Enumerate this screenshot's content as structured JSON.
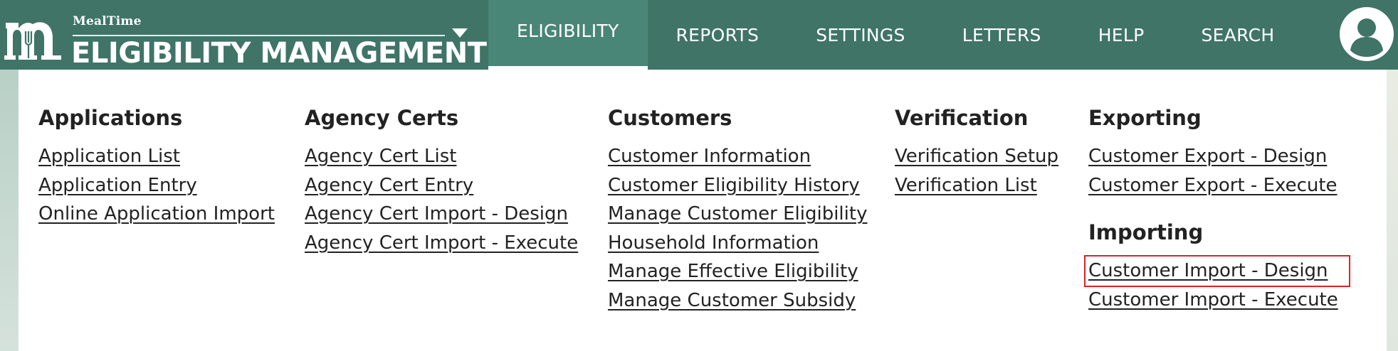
{
  "header": {
    "brand_small": "MealTime",
    "brand_title": "ELIGIBILITY MANAGEMENT",
    "logo_icon": "mealtime-m-fork-logo",
    "dropdown_icon": "caret-down-icon",
    "avatar_icon": "user-avatar-icon"
  },
  "nav": [
    {
      "label": "ELIGIBILITY",
      "active": true
    },
    {
      "label": "REPORTS"
    },
    {
      "label": "SETTINGS"
    },
    {
      "label": "LETTERS"
    },
    {
      "label": "HELP"
    },
    {
      "label": "SEARCH"
    }
  ],
  "menu": {
    "applications": {
      "heading": "Applications",
      "items": [
        "Application List",
        "Application Entry",
        "Online Application Import"
      ]
    },
    "agency_certs": {
      "heading": "Agency Certs",
      "items": [
        "Agency Cert List",
        "Agency Cert Entry",
        "Agency Cert Import - Design",
        "Agency Cert Import - Execute"
      ]
    },
    "customers": {
      "heading": "Customers",
      "items": [
        "Customer Information",
        "Customer Eligibility History",
        "Manage Customer Eligibility",
        "Household Information",
        "Manage Effective Eligibility",
        "Manage Customer Subsidy"
      ]
    },
    "verification": {
      "heading": "Verification",
      "items": [
        "Verification Setup",
        "Verification List"
      ]
    },
    "exporting": {
      "heading": "Exporting",
      "items": [
        "Customer Export - Design",
        "Customer Export - Execute"
      ]
    },
    "importing": {
      "heading": "Importing",
      "items": [
        "Customer Import - Design",
        "Customer Import - Execute"
      ]
    }
  },
  "colors": {
    "header_bg": "#3f7467",
    "active_tab_bg": "#4a8677",
    "highlight_outline": "#e02020"
  }
}
